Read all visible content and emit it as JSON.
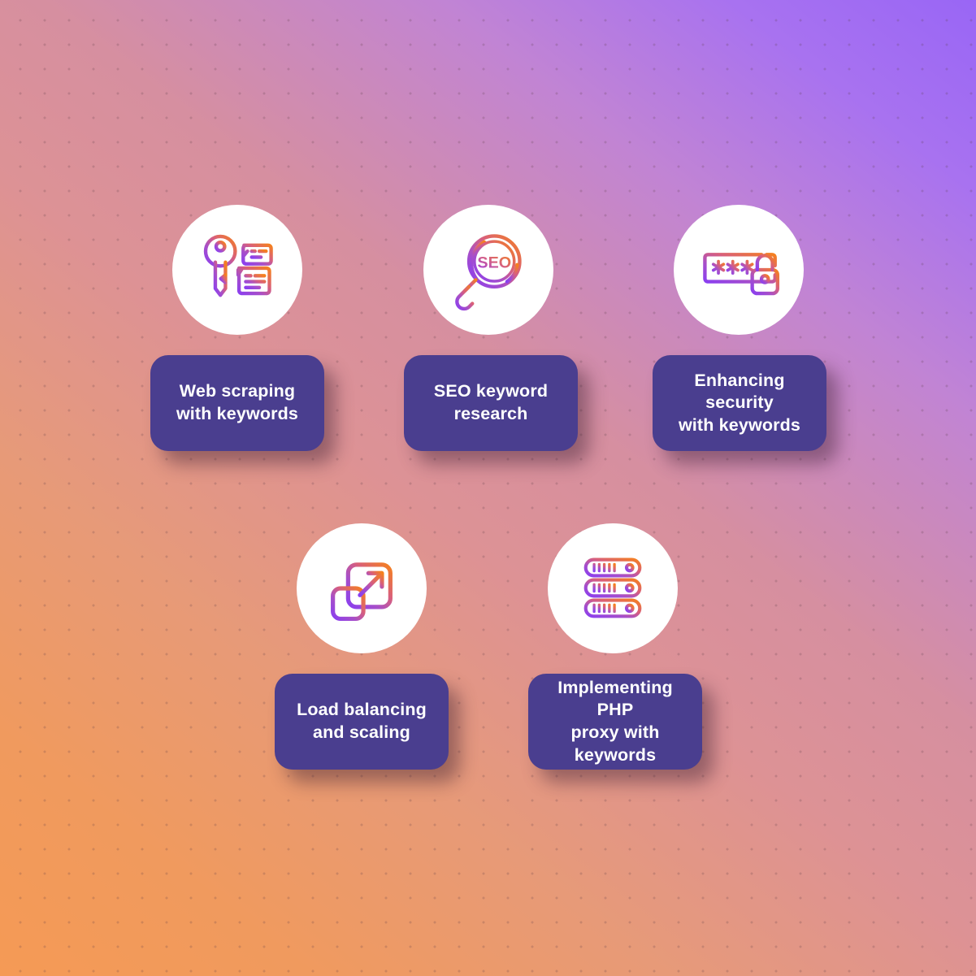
{
  "background": {
    "gradient_from": "#f59a55",
    "gradient_mid": "#d68fa0",
    "gradient_to": "#9966f5",
    "dot_pattern": "dotted-grid"
  },
  "theme": {
    "card_color": "#4a3e8f",
    "card_text_color": "#ffffff",
    "circle_color": "#ffffff",
    "icon_gradient_start": "#8a3ff0",
    "icon_gradient_end": "#f5801e"
  },
  "nodes": [
    {
      "id": "web-scraping",
      "label": "Web scraping\nwith keywords",
      "icon": "key-with-documents-icon"
    },
    {
      "id": "seo-research",
      "label": "SEO keyword\nresearch",
      "icon": "seo-magnifier-icon",
      "icon_text": "SEO"
    },
    {
      "id": "security",
      "label": "Enhancing security\nwith keywords",
      "icon": "password-lock-icon"
    },
    {
      "id": "load-balancing",
      "label": "Load balancing\nand scaling",
      "icon": "scale-arrow-squares-icon"
    },
    {
      "id": "php-proxy",
      "label": "Implementing PHP\nproxy with keywords",
      "icon": "server-rack-icon"
    }
  ]
}
